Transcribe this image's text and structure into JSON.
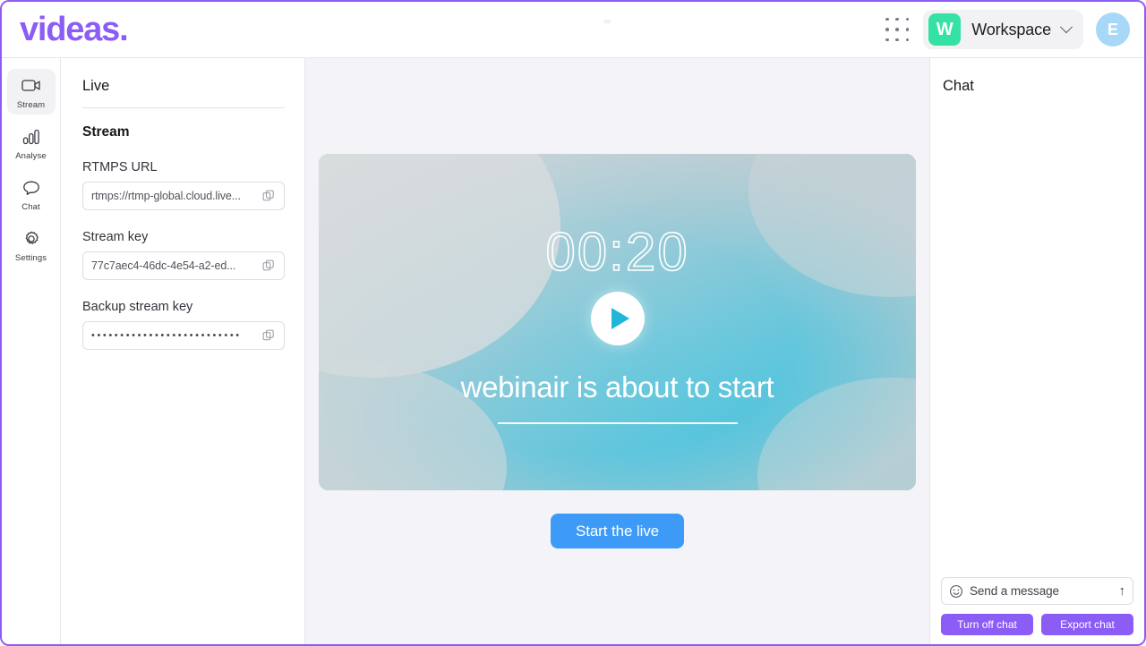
{
  "app": {
    "logo_text": "videas.",
    "accent_purple": "#8B5CF6",
    "accent_blue": "#3D9BF7",
    "badge_green": "#34E2A4",
    "avatar_blue": "#A7D8F7"
  },
  "topbar": {
    "apps_grid_icon": "grid-dots-icon",
    "workspace_initial": "W",
    "workspace_name": "Workspace",
    "workspace_chevron_icon": "chevron-down-icon",
    "avatar_initial": "E"
  },
  "rail": {
    "items": [
      {
        "label": "Stream",
        "icon": "video-camera-icon",
        "active": true
      },
      {
        "label": "Analyse",
        "icon": "bar-chart-icon",
        "active": false
      },
      {
        "label": "Chat",
        "icon": "speech-bubble-icon",
        "active": false
      },
      {
        "label": "Settings",
        "icon": "gear-icon",
        "active": false
      }
    ]
  },
  "settings": {
    "section_title": "Live",
    "subsection_title": "Stream",
    "fields": [
      {
        "label": "RTMPS URL",
        "value": "rtmps://rtmp-global.cloud.live...",
        "masked": false,
        "copy_icon": "copy-icon"
      },
      {
        "label": "Stream key",
        "value": "77c7aec4-46dc-4e54-a2-ed...",
        "masked": false,
        "copy_icon": "copy-icon"
      },
      {
        "label": "Backup stream key",
        "value": "••••••••••••••••••••••••••",
        "masked": true,
        "copy_icon": "copy-icon"
      }
    ]
  },
  "stage": {
    "timer": "00:20",
    "play_icon": "play-icon",
    "headline": "webinair is about to start",
    "start_button_label": "Start the live"
  },
  "chat": {
    "title": "Chat",
    "emoji_icon": "smiley-icon",
    "input_placeholder": "Send a message",
    "input_value": "",
    "send_icon": "arrow-up-icon",
    "turn_off_label": "Turn off chat",
    "export_label": "Export chat"
  }
}
